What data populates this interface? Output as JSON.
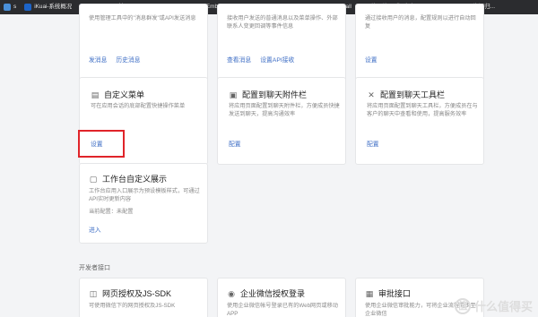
{
  "bookmarks": [
    {
      "label": "s",
      "color": "#4a90d9"
    },
    {
      "label": "iKuai-系统概况",
      "color": "#1c64c8"
    },
    {
      "label": "iStoreOS - 首页 -...",
      "color": "#5b5bd6"
    },
    {
      "label": "Home | AList",
      "color": "#3b82f6"
    },
    {
      "label": "Emby",
      "color": "#52b54b"
    },
    {
      "label": "ChatGPT Web",
      "color": "#111111"
    },
    {
      "label": "AriaNg",
      "color": "#2a7ae2"
    },
    {
      "label": "Heimdall",
      "color": "#8a8a8a"
    },
    {
      "label": "咩哩咩哩（゜-゜）つ...",
      "color": "#fb7299"
    },
    {
      "label": "NASTool - 资源归...",
      "color": "#1e88e5"
    }
  ],
  "top_cards": [
    {
      "desc": "使用管理工具中的\"消息群发\"或API发送消息",
      "actions": [
        "发消息",
        "历史消息"
      ]
    },
    {
      "desc": "接收用户发送的普通消息以及菜单操作、外部联系人变更回调等事件信息",
      "actions": [
        "查看消息",
        "设置API接收"
      ]
    },
    {
      "desc": "通过接收用户的消息，配置规则以进行自动回复",
      "actions": [
        "设置"
      ]
    }
  ],
  "mid_cards": [
    {
      "title": "自定义菜单",
      "icon": "menu-icon",
      "desc": "可在应用会话的底部配置快捷操作菜单",
      "actions": [
        "设置"
      ]
    },
    {
      "title": "配置到聊天附件栏",
      "icon": "attachment-icon",
      "desc": "将应用页面配置到聊天附件栏，方便成员快捷发送到聊天，提高沟通效率",
      "actions": [
        "配置"
      ]
    },
    {
      "title": "配置到聊天工具栏",
      "icon": "tools-icon",
      "desc": "将应用页面配置到聊天工具栏，方便成员在与客户的聊天中查看和使用，提高服务效率",
      "actions": [
        "配置"
      ]
    }
  ],
  "workbench_card": {
    "title": "工作台自定义展示",
    "icon": "workbench-icon",
    "desc": "工作台应用入口展示为预设模板样式，可通过API实时更新内容",
    "status": "当前配置：未配置",
    "actions": [
      "进入"
    ]
  },
  "section_title": "开发者接口",
  "bottom_cards": [
    {
      "title": "网页授权及JS-SDK",
      "icon": "web-auth-icon",
      "desc": "可使用微信下的网页授权及JS-SDK"
    },
    {
      "title": "企业微信授权登录",
      "icon": "login-icon",
      "desc": "使用企业微信帐号登录已有的Web网页或移动APP"
    },
    {
      "title": "审批接口",
      "icon": "approval-icon",
      "desc": "使用企业微信审批能力，可将企业流程同步至企业微信"
    }
  ],
  "watermark": {
    "icon": "值",
    "text": "什么值得买"
  }
}
